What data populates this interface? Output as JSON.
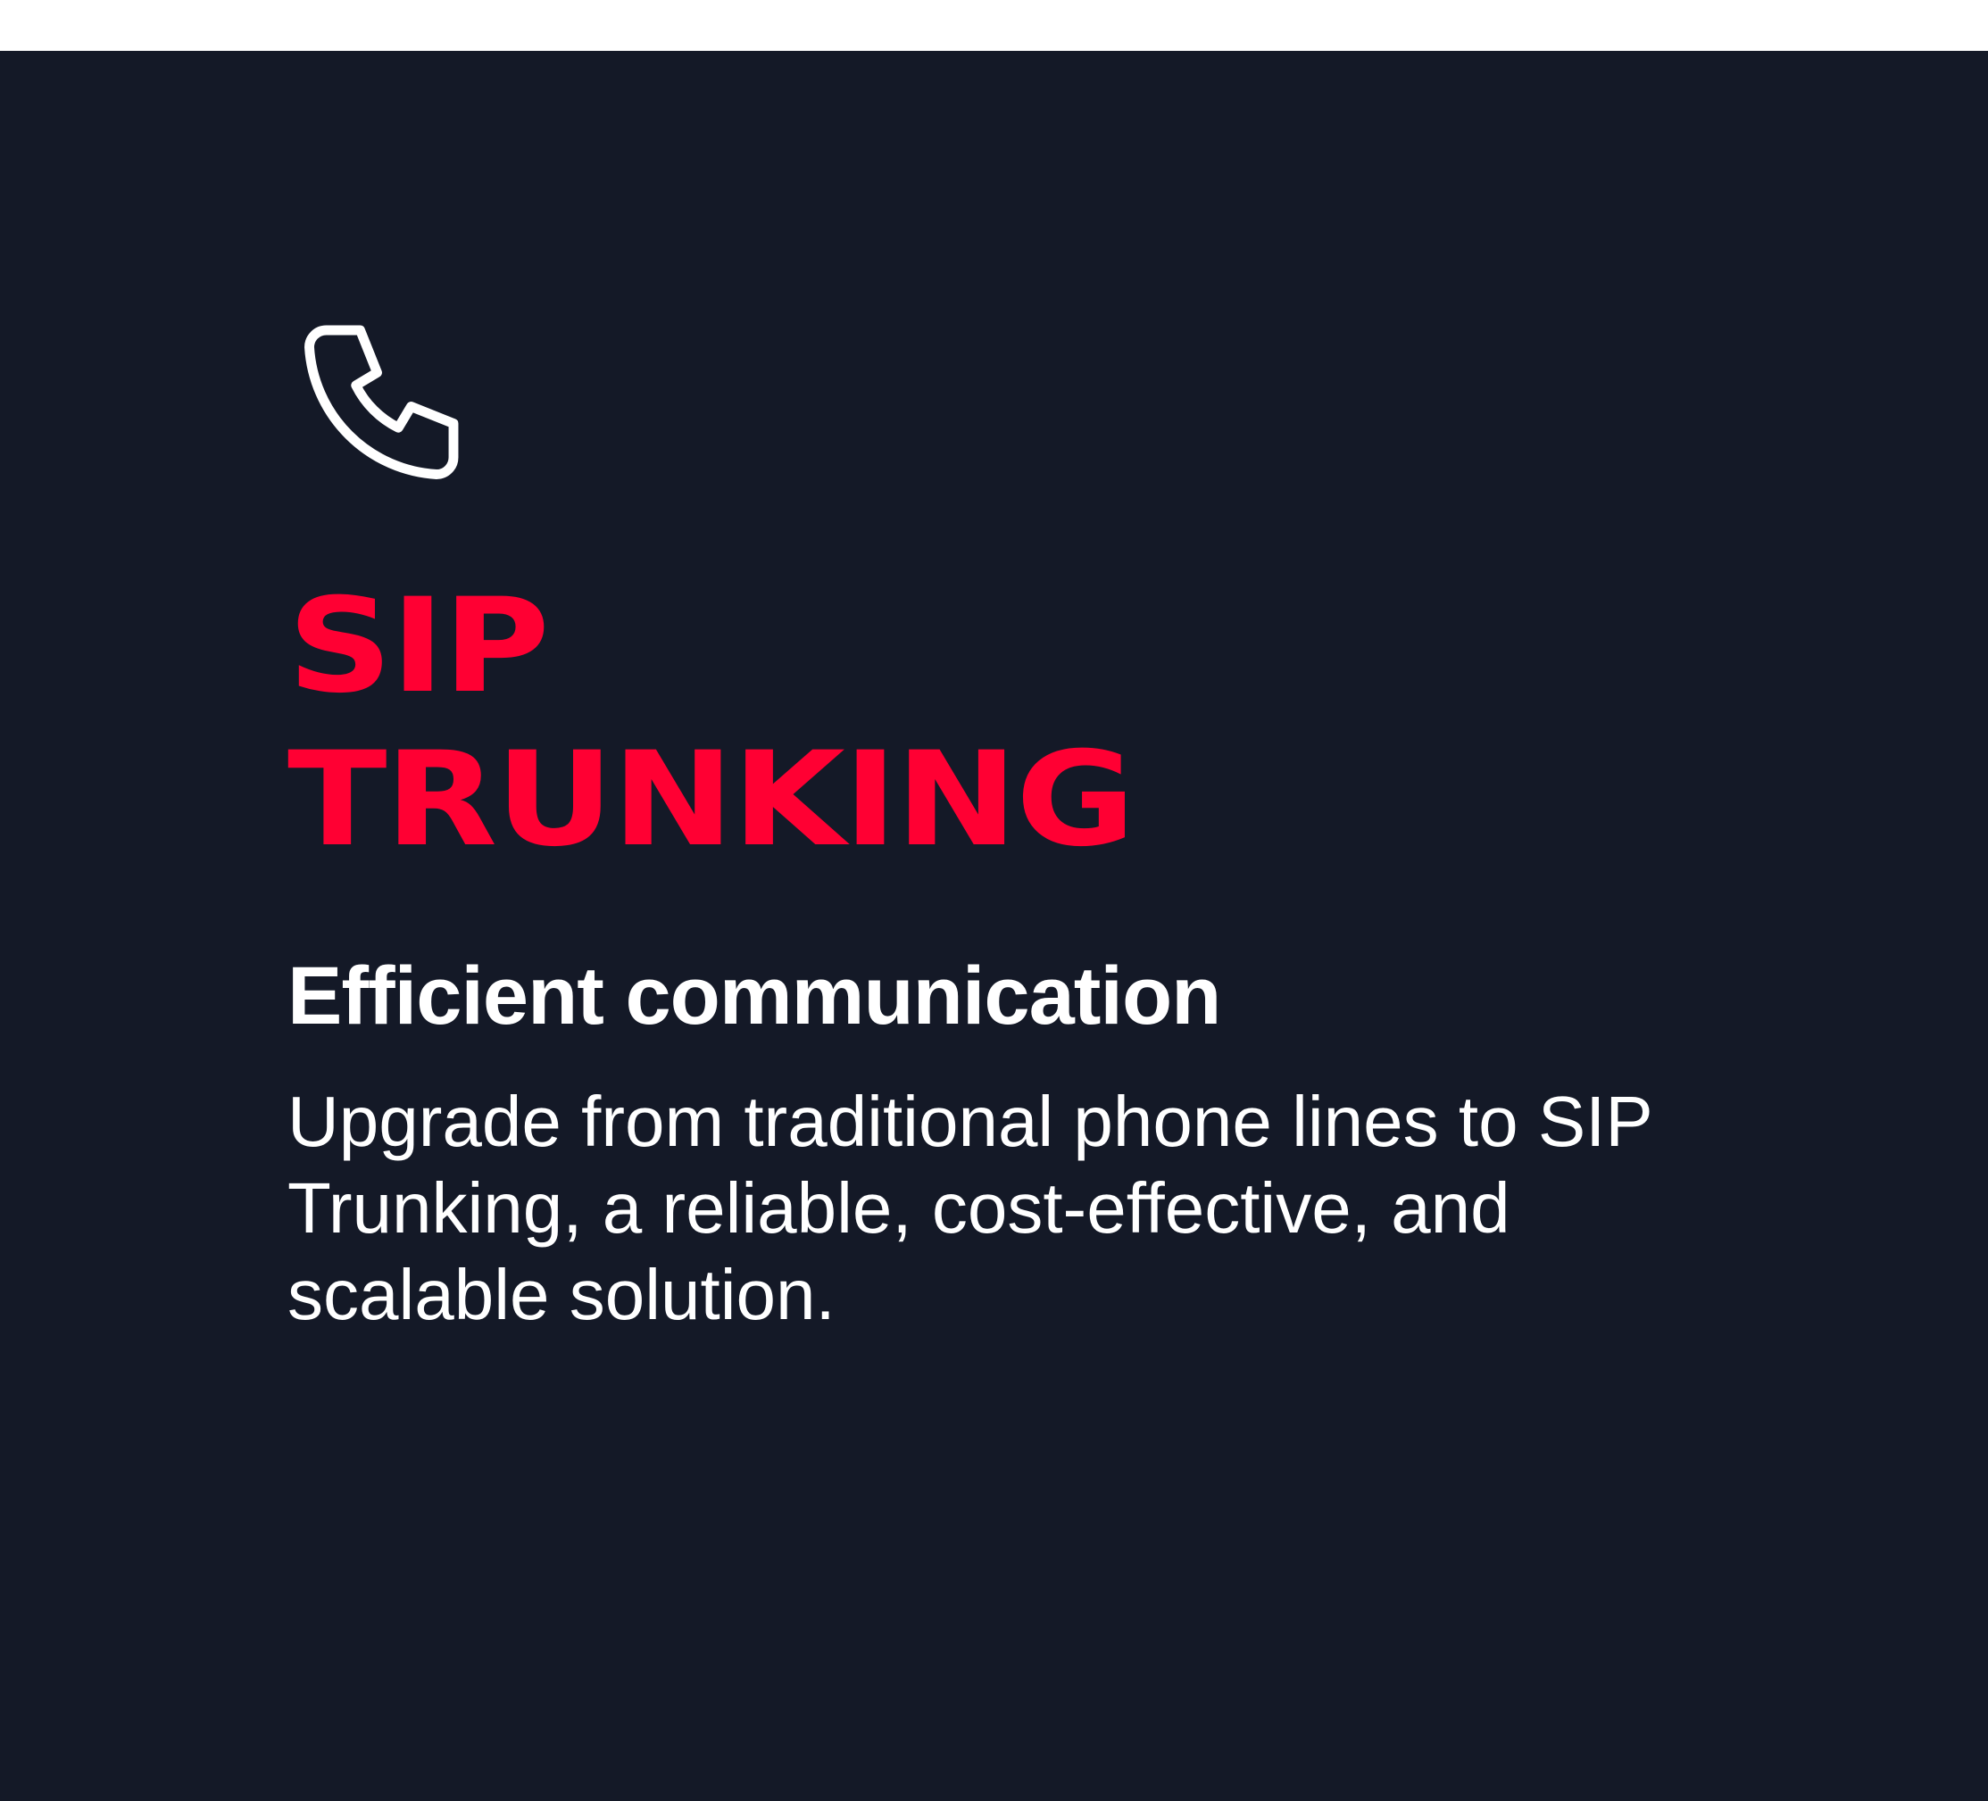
{
  "card": {
    "icon": "phone-icon",
    "title_line1": "SIP",
    "title_line2": "TRUNKING",
    "subtitle": "Efficient communication",
    "description": "Upgrade from traditional phone lines to SIP Trunking, a reliable, cost-effective, and scalable solution."
  },
  "colors": {
    "background": "#141927",
    "accent": "#ff0033",
    "text": "#ffffff"
  }
}
